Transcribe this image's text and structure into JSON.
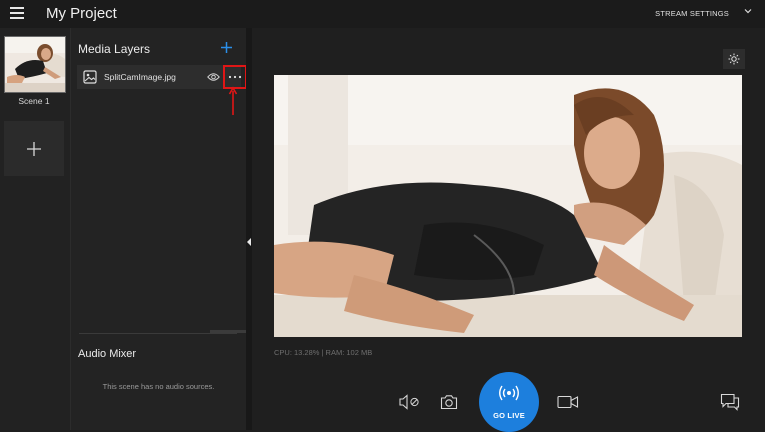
{
  "header": {
    "title": "My Project",
    "stream_settings_label": "STREAM SETTINGS"
  },
  "scenes": {
    "items": [
      {
        "label": "Scene 1"
      }
    ]
  },
  "media_layers": {
    "title": "Media Layers",
    "items": [
      {
        "name": "SplitCamImage.jpg"
      }
    ]
  },
  "audio_mixer": {
    "title": "Audio Mixer",
    "empty_text": "This scene has no audio sources."
  },
  "preview": {
    "stats": "CPU: 13.28% | RAM: 102 MB"
  },
  "toolbar": {
    "go_live_label": "GO LIVE"
  },
  "colors": {
    "accent": "#1d7fdd",
    "annotation": "#e01616",
    "background": "#1f1f1f"
  }
}
